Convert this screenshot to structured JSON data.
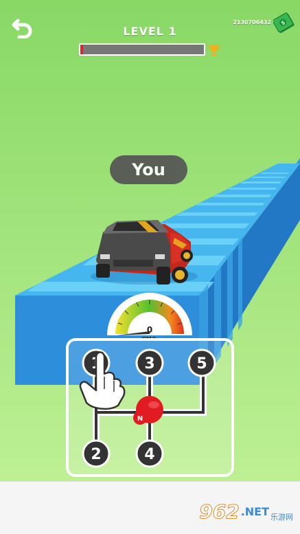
{
  "hud": {
    "level_label": "LEVEL 1",
    "money": "2130706432",
    "progress": 0.02
  },
  "player_label": "You",
  "speedometer": {
    "speed": "0",
    "unit": "KM/h"
  },
  "gearbox": {
    "gears": [
      "1",
      "3",
      "5",
      "2",
      "4"
    ],
    "neutral": "N",
    "current": "N"
  },
  "watermark": {
    "number": "962",
    "suffix": ".NET",
    "cn": "乐游网"
  },
  "colors": {
    "sky_top": "#90dc6c",
    "sky_bottom": "#b8ee90",
    "road": "#3fb0ec",
    "road_side": "#2a8fd4",
    "knob": "#e01c22"
  }
}
